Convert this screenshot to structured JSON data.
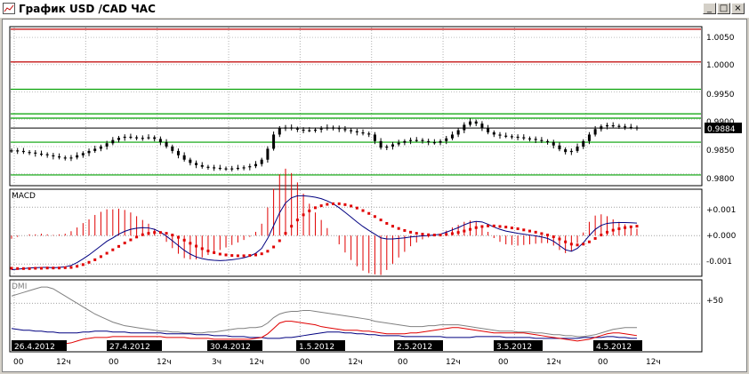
{
  "window": {
    "title": "График USD /CAD  ЧАС",
    "min_label": "_",
    "max_label": "□",
    "close_label": "×"
  },
  "price_panel": {
    "ticks": [
      "1.0050",
      "1.0000",
      "0.9950",
      "0.9900",
      "0.9850",
      "0.9800"
    ],
    "current_price": "0.9884",
    "colors": {
      "red_line": "#c00000",
      "green_line": "#00a000",
      "candles": "#000000"
    }
  },
  "macd_panel": {
    "label": "MACD",
    "ticks": [
      "+0.001",
      "+0.000",
      "-0.001"
    ],
    "colors": {
      "line": "#000080",
      "signal": "#e00000",
      "histogram": "#e00000"
    }
  },
  "dmi_panel": {
    "label": "DMI",
    "ticks": [
      "+50"
    ],
    "colors": {
      "adx": "#808080",
      "plus_di": "#000080",
      "minus_di": "#e00000"
    }
  },
  "time_axis": {
    "dates": [
      "26.4.2012",
      "27.4.2012",
      "30.4.2012",
      "1.5.2012",
      "2.5.2012",
      "3.5.2012",
      "4.5.2012"
    ],
    "hours": [
      "00",
      "12ч",
      "00",
      "12ч",
      "3ч",
      "12ч",
      "00",
      "12ч",
      "00",
      "12ч",
      "00",
      "12ч",
      "00",
      "12ч"
    ]
  },
  "chart_data": [
    {
      "type": "candlestick",
      "title": "График USD /CAD  ЧАС",
      "ylim": [
        0.978,
        1.0068
      ],
      "yticks": [
        1.005,
        1.0,
        0.995,
        0.99,
        0.985,
        0.98
      ],
      "horizontal_lines": [
        {
          "value": 1.0065,
          "color": "#c00000"
        },
        {
          "value": 1.0005,
          "color": "#c00000"
        },
        {
          "value": 0.9955,
          "color": "#00a000"
        },
        {
          "value": 0.991,
          "color": "#00a000"
        },
        {
          "value": 0.9902,
          "color": "#00a000"
        },
        {
          "value": 0.9858,
          "color": "#00a000"
        },
        {
          "value": 0.9798,
          "color": "#00a000"
        }
      ],
      "current_price": 0.9884,
      "close": [
        0.9843,
        0.9842,
        0.984,
        0.9839,
        0.9837,
        0.9836,
        0.9834,
        0.9832,
        0.983,
        0.9829,
        0.983,
        0.9834,
        0.9838,
        0.9842,
        0.9846,
        0.985,
        0.9856,
        0.9862,
        0.9866,
        0.9868,
        0.9867,
        0.9866,
        0.9866,
        0.9867,
        0.9864,
        0.9858,
        0.985,
        0.9842,
        0.9834,
        0.9826,
        0.982,
        0.9816,
        0.9813,
        0.9812,
        0.9811,
        0.981,
        0.981,
        0.981,
        0.9811,
        0.9812,
        0.9814,
        0.9818,
        0.9826,
        0.9846,
        0.9872,
        0.9884,
        0.9885,
        0.9883,
        0.9881,
        0.988,
        0.988,
        0.9881,
        0.9883,
        0.9885,
        0.9884,
        0.9882,
        0.988,
        0.9878,
        0.9876,
        0.9874,
        0.9872,
        0.986,
        0.9848,
        0.985,
        0.9854,
        0.9857,
        0.986,
        0.9862,
        0.9862,
        0.986,
        0.9858,
        0.9857,
        0.986,
        0.9865,
        0.9872,
        0.988,
        0.989,
        0.9896,
        0.9892,
        0.9884,
        0.9876,
        0.9872,
        0.987,
        0.9869,
        0.9868,
        0.9867,
        0.9865,
        0.9864,
        0.9862,
        0.986,
        0.9858,
        0.9852,
        0.9845,
        0.984,
        0.9842,
        0.985,
        0.986,
        0.9872,
        0.9882,
        0.9887,
        0.9889,
        0.9888,
        0.9887,
        0.9886,
        0.9885,
        0.9884
      ]
    },
    {
      "type": "line",
      "title": "MACD",
      "ylim": [
        -0.0014,
        0.0016
      ],
      "series": [
        {
          "values": [
            -0.0012,
            -0.00118,
            -0.00116,
            -0.00114,
            -0.00113,
            -0.00112,
            -0.00112,
            -0.00113,
            -0.00112,
            -0.0011,
            -0.00105,
            -0.00095,
            -0.00082,
            -0.00068,
            -0.00052,
            -0.00036,
            -0.0002,
            -8e-05,
            5e-05,
            0.00015,
            0.00022,
            0.00026,
            0.00028,
            0.00027,
            0.00022,
            0.00012,
            -2e-05,
            -0.00018,
            -0.00035,
            -0.00052,
            -0.00065,
            -0.00075,
            -0.00081,
            -0.00085,
            -0.00087,
            -0.00088,
            -0.00087,
            -0.00085,
            -0.00082,
            -0.00078,
            -0.00072,
            -0.00062,
            -0.00045,
            -0.0001,
            0.00035,
            0.0008,
            0.00115,
            0.00133,
            0.0014,
            0.0014,
            0.00138,
            0.00135,
            0.0013,
            0.00122,
            0.00112,
            0.00098,
            0.00082,
            0.00065,
            0.00048,
            0.00032,
            0.00018,
            5e-05,
            -8e-05,
            -0.00012,
            -0.00012,
            -0.0001,
            -8e-05,
            -5e-05,
            -3e-05,
            -1e-05,
            0.0,
            2e-05,
            5e-05,
            0.00012,
            0.0002,
            0.00028,
            0.00038,
            0.00046,
            0.0005,
            0.00048,
            0.0004,
            0.0003,
            0.00022,
            0.00016,
            0.00012,
            8e-05,
            5e-05,
            2e-05,
            -1e-05,
            -5e-05,
            -0.0001,
            -0.0002,
            -0.00035,
            -0.0005,
            -0.00055,
            -0.00045,
            -0.00025,
            0.0,
            0.00022,
            0.00036,
            0.00043,
            0.00045,
            0.00046,
            0.00046,
            0.00045,
            0.00044
          ]
        },
        {
          "values": [
            -0.00115,
            -0.00116,
            -0.00116,
            -0.00116,
            -0.00115,
            -0.00115,
            -0.00114,
            -0.00114,
            -0.00114,
            -0.00113,
            -0.00112,
            -0.00108,
            -0.00102,
            -0.00094,
            -0.00085,
            -0.00074,
            -0.00062,
            -0.0005,
            -0.00038,
            -0.00026,
            -0.00015,
            -5e-05,
            3e-05,
            8e-05,
            0.00011,
            0.00011,
            8e-05,
            2e-05,
            -6e-05,
            -0.00016,
            -0.00027,
            -0.00037,
            -0.00046,
            -0.00054,
            -0.0006,
            -0.00065,
            -0.00068,
            -0.0007,
            -0.00071,
            -0.00071,
            -0.0007,
            -0.00068,
            -0.00064,
            -0.00055,
            -0.0004,
            -0.00018,
            8e-05,
            0.00033,
            0.00055,
            0.00073,
            0.00087,
            0.00098,
            0.00105,
            0.0011,
            0.00112,
            0.00112,
            0.00109,
            0.00104,
            0.00097,
            0.00088,
            0.00078,
            0.00067,
            0.00055,
            0.00043,
            0.00033,
            0.00025,
            0.00018,
            0.00012,
            8e-05,
            5e-05,
            3e-05,
            2e-05,
            2e-05,
            4e-05,
            7e-05,
            0.00011,
            0.00016,
            0.00022,
            0.00028,
            0.00032,
            0.00034,
            0.00034,
            0.00032,
            0.0003,
            0.00027,
            0.00024,
            0.0002,
            0.00016,
            0.00012,
            7e-05,
            2e-05,
            -4e-05,
            -0.00012,
            -0.00022,
            -0.0003,
            -0.00033,
            -0.0003,
            -0.00022,
            -0.0001,
            2e-05,
            0.00012,
            0.00019,
            0.00024,
            0.00028,
            0.00031,
            0.00033
          ]
        }
      ],
      "histogram": "macd_minus_signal"
    },
    {
      "type": "line",
      "title": "DMI",
      "ylim": [
        0,
        75
      ],
      "series": [
        {
          "values": [
            58,
            60,
            62,
            64,
            66,
            68,
            68,
            66,
            62,
            58,
            54,
            50,
            46,
            42,
            38,
            35,
            32,
            29,
            27,
            25,
            24,
            23,
            22,
            21,
            20,
            19,
            19,
            18,
            18,
            17,
            17,
            17,
            17,
            18,
            18,
            19,
            20,
            21,
            22,
            22,
            23,
            23,
            24,
            28,
            34,
            38,
            40,
            41,
            41,
            42,
            42,
            41,
            40,
            39,
            38,
            37,
            36,
            35,
            34,
            33,
            32,
            30,
            29,
            28,
            27,
            26,
            25,
            24,
            24,
            24,
            25,
            25,
            26,
            26,
            26,
            26,
            25,
            24,
            23,
            22,
            21,
            20,
            19,
            19,
            19,
            18,
            18,
            18,
            17,
            17,
            16,
            15,
            15,
            14,
            14,
            13,
            13,
            14,
            15,
            17,
            19,
            21,
            22,
            23,
            23,
            23
          ]
        },
        {
          "values": [
            22,
            21,
            20,
            20,
            19,
            19,
            18,
            18,
            17,
            17,
            17,
            17,
            18,
            18,
            19,
            19,
            19,
            18,
            18,
            18,
            17,
            17,
            17,
            17,
            17,
            17,
            16,
            16,
            16,
            16,
            16,
            15,
            15,
            15,
            14,
            14,
            14,
            13,
            13,
            13,
            12,
            12,
            12,
            11,
            11,
            11,
            12,
            12,
            13,
            14,
            15,
            16,
            17,
            18,
            18,
            18,
            17,
            17,
            16,
            16,
            15,
            15,
            14,
            14,
            14,
            14,
            13,
            13,
            13,
            13,
            13,
            13,
            13,
            12,
            12,
            12,
            12,
            12,
            13,
            13,
            13,
            13,
            13,
            12,
            12,
            12,
            12,
            12,
            11,
            11,
            11,
            11,
            11,
            11,
            11,
            11,
            12,
            12,
            12,
            12,
            13,
            13,
            12,
            12,
            11,
            11
          ]
        },
        {
          "values": [
            2,
            2,
            3,
            3,
            3,
            3,
            3,
            4,
            4,
            5,
            6,
            8,
            10,
            11,
            12,
            12,
            12,
            13,
            13,
            13,
            13,
            13,
            13,
            13,
            13,
            13,
            12,
            12,
            12,
            12,
            11,
            11,
            11,
            11,
            10,
            10,
            10,
            10,
            10,
            10,
            10,
            11,
            12,
            16,
            22,
            28,
            30,
            30,
            29,
            28,
            27,
            26,
            24,
            23,
            22,
            21,
            20,
            20,
            20,
            19,
            19,
            18,
            17,
            16,
            16,
            16,
            16,
            17,
            17,
            18,
            19,
            20,
            21,
            22,
            23,
            23,
            22,
            21,
            20,
            19,
            18,
            17,
            17,
            17,
            17,
            17,
            17,
            16,
            15,
            14,
            13,
            12,
            11,
            10,
            9,
            8,
            9,
            10,
            12,
            14,
            16,
            17,
            17,
            16,
            15,
            14
          ]
        }
      ]
    }
  ]
}
